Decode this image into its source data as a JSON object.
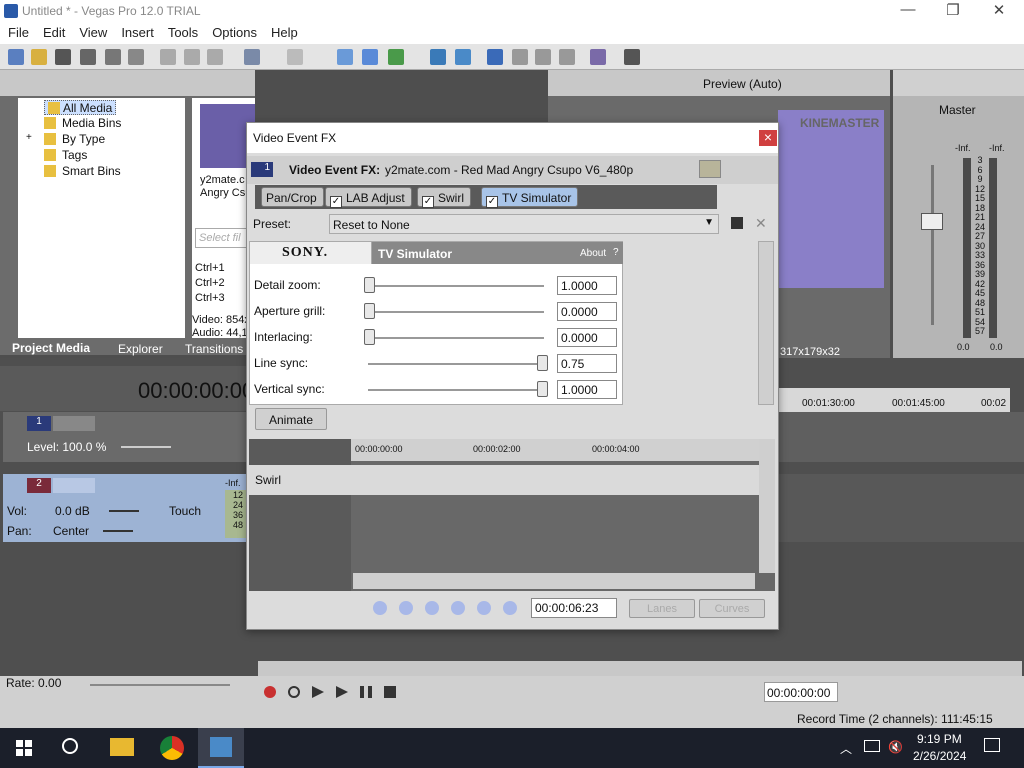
{
  "app": {
    "title": "Untitled * - Vegas Pro 12.0 TRIAL",
    "window_controls": {
      "minimize": "—",
      "restore": "❐",
      "close": "✕"
    }
  },
  "menu": [
    "File",
    "Edit",
    "View",
    "Insert",
    "Tools",
    "Options",
    "Help"
  ],
  "project_media": {
    "tree": [
      "All Media",
      "Media Bins",
      "By Type",
      "Tags",
      "Smart Bins"
    ],
    "tree_expander": "+",
    "thumb_caption_1": "y2mate.c",
    "thumb_caption_2": "Angry Csu",
    "search_placeholder": "Select fil",
    "shortcuts": [
      "Ctrl+1",
      "Ctrl+2",
      "Ctrl+3"
    ],
    "info_video": "Video: 854x",
    "info_audio": "Audio: 44,1",
    "tabs": [
      "Project Media",
      "Explorer",
      "Transitions"
    ]
  },
  "preview": {
    "label": "Preview (Auto)",
    "watermark": "KINEMASTER",
    "resolution": "317x179x32"
  },
  "master": {
    "label": "Master",
    "inf_left": "-Inf.",
    "inf_right": "-Inf.",
    "scale": [
      "3",
      "6",
      "9",
      "12",
      "15",
      "18",
      "21",
      "24",
      "27",
      "30",
      "33",
      "36",
      "39",
      "42",
      "45",
      "48",
      "51",
      "54",
      "57"
    ],
    "readout_left": "0.0",
    "readout_right": "0.0"
  },
  "timeline": {
    "timecode": "00:00:00:00",
    "ruler": [
      "00:01:30:00",
      "00:01:45:00",
      "00:02"
    ],
    "track1": {
      "number": "1",
      "level": "Level: 100.0 %"
    },
    "track2": {
      "number": "2",
      "vol_label": "Vol:",
      "vol_value": "0.0 dB",
      "pan_label": "Pan:",
      "pan_value": "Center",
      "mode": "Touch",
      "inf": "-Inf.",
      "scale": [
        "12",
        "24",
        "36",
        "48"
      ]
    },
    "rate": "Rate: 0.00",
    "transport_timecode": "00:00:00:00",
    "record_time": "Record Time (2 channels): 111:45:15"
  },
  "dialog": {
    "title": "Video Event FX",
    "close": "×",
    "track_badge": "1",
    "event_label": "Video Event FX:",
    "event_name": "y2mate.com - Red Mad Angry Csupo V6_480p",
    "chain": [
      "Pan/Crop",
      "LAB Adjust",
      "Swirl",
      "TV Simulator"
    ],
    "preset_label": "Preset:",
    "preset_value": "Reset to None",
    "plugin_brand": "SONY.",
    "plugin_name": "TV Simulator",
    "about": "About",
    "about_q": "?",
    "params": [
      {
        "label": "Detail zoom:",
        "value": "1.0000",
        "pos": 0.0
      },
      {
        "label": "Aperture grill:",
        "value": "0.0000",
        "pos": 0.0
      },
      {
        "label": "Interlacing:",
        "value": "0.0000",
        "pos": 0.0
      },
      {
        "label": "Line sync:",
        "value": "0.75",
        "pos": 1.0
      },
      {
        "label": "Vertical sync:",
        "value": "1.0000",
        "pos": 1.0
      }
    ],
    "animate": "Animate",
    "kf_ruler": [
      "00:00:00:00",
      "00:00:02:00",
      "00:00:04:00"
    ],
    "kf_track": "Swirl",
    "kf_timecode": "00:00:06:23",
    "lanes": "Lanes",
    "curves": "Curves"
  },
  "taskbar": {
    "time": "9:19 PM",
    "date": "2/26/2024"
  }
}
